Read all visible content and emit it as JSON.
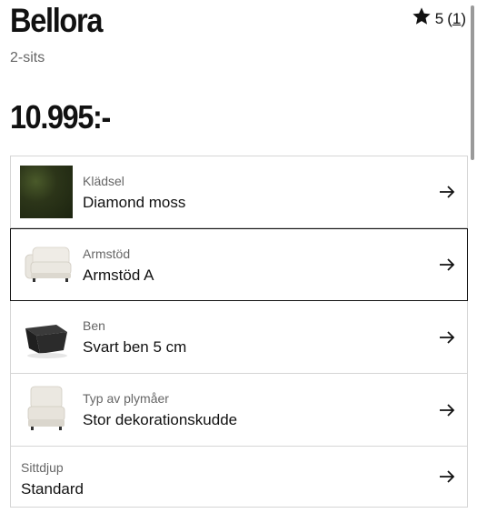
{
  "product": {
    "name": "Bellora",
    "variant": "2-sits",
    "price": "10.995:-",
    "rating": {
      "score": "5",
      "count": "1"
    }
  },
  "options": [
    {
      "label": "Klädsel",
      "value": "Diamond moss",
      "icon": "fabric-swatch"
    },
    {
      "label": "Armstöd",
      "value": "Armstöd A",
      "icon": "armrest-sofa-image"
    },
    {
      "label": "Ben",
      "value": "Svart ben 5 cm",
      "icon": "black-leg-image"
    },
    {
      "label": "Typ av plymåer",
      "value": "Stor dekorationskudde",
      "icon": "cushion-chair-image"
    },
    {
      "label": "Sittdjup",
      "value": "Standard",
      "icon": ""
    }
  ],
  "colors": {
    "selected_border": "#111111",
    "border": "#d5d5d5",
    "muted_text": "#666666"
  }
}
